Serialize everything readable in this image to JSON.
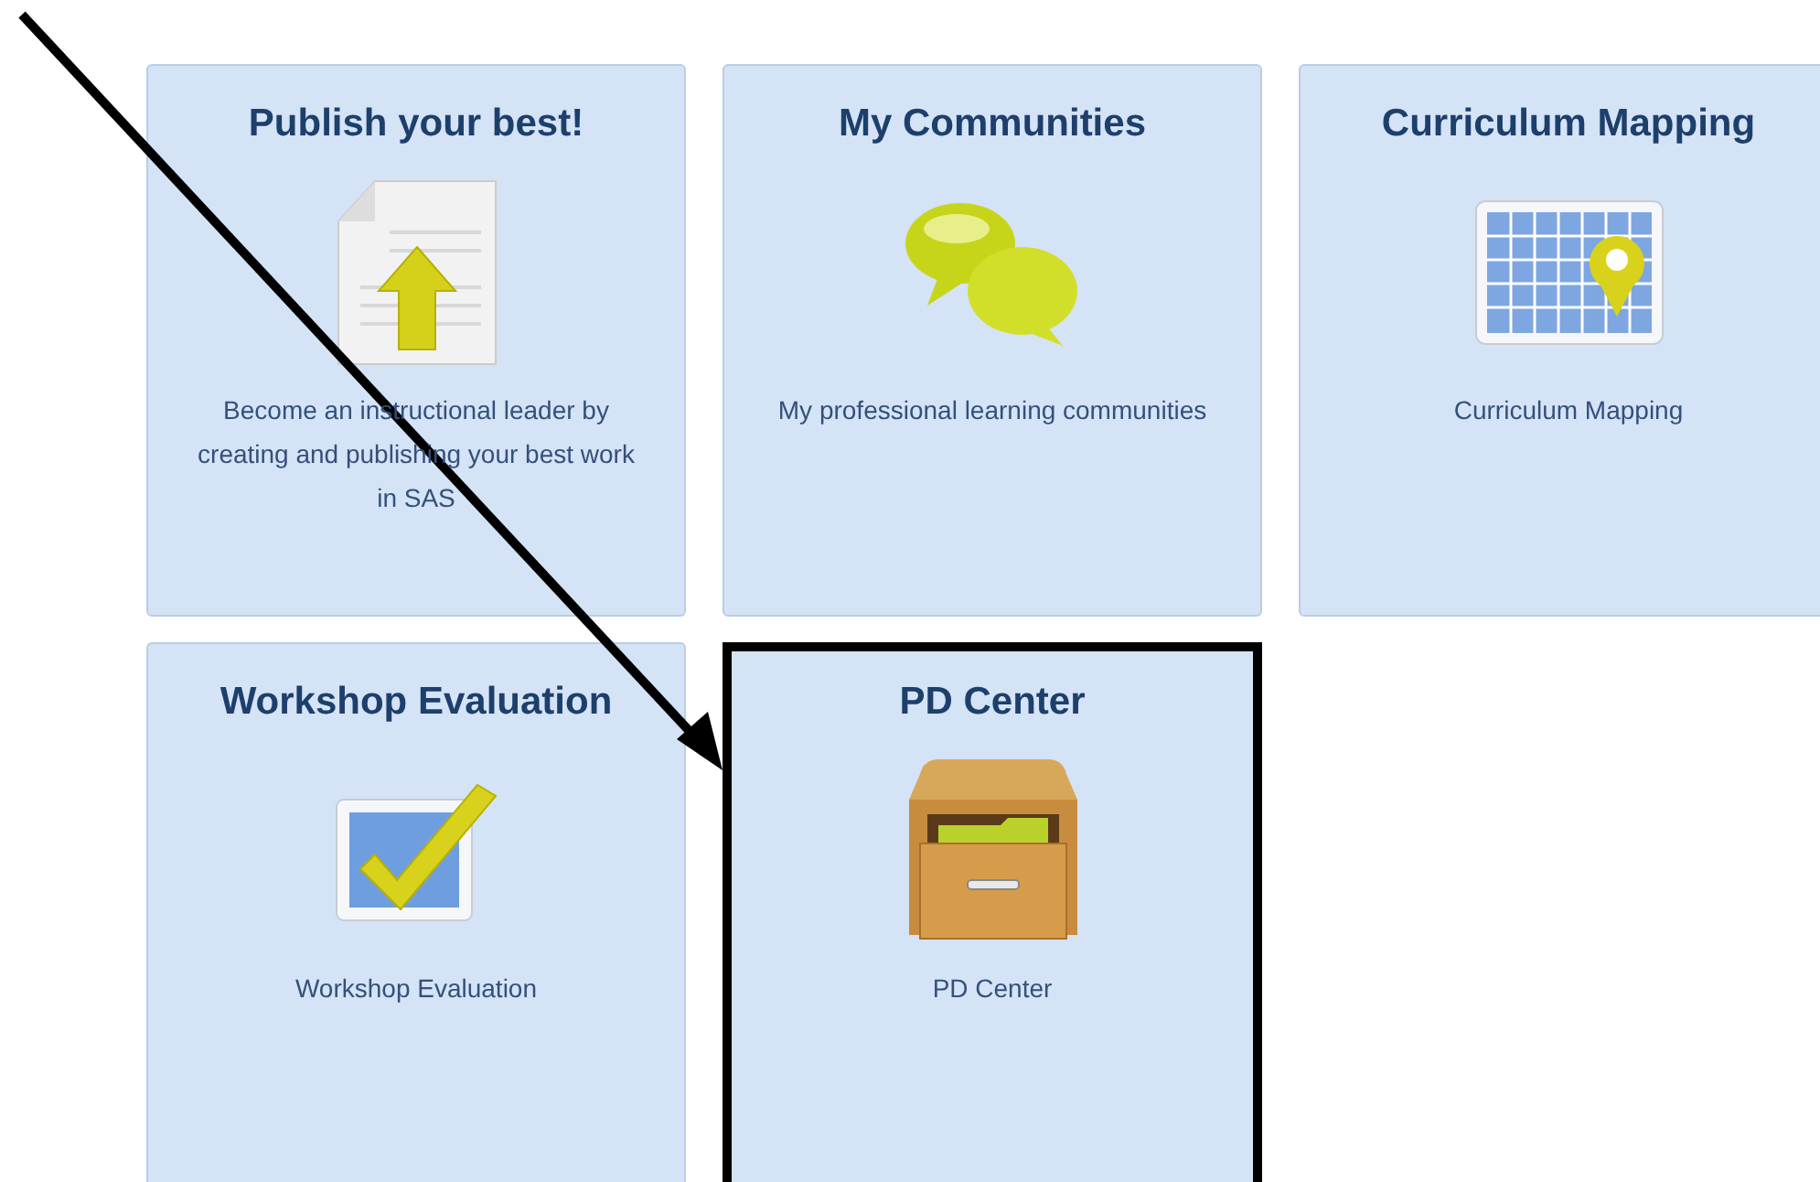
{
  "tiles": [
    {
      "title": "Publish your best!",
      "description": "Become an instructional leader by creating and publishing your best work in SAS",
      "highlighted": false
    },
    {
      "title": "My Communities",
      "description": "My professional learning communities",
      "highlighted": false
    },
    {
      "title": "Curriculum Mapping",
      "description": "Curriculum Mapping",
      "highlighted": false
    },
    {
      "title": "Workshop Evaluation",
      "description": "Workshop Evaluation",
      "highlighted": false
    },
    {
      "title": "PD Center",
      "description": "PD Center",
      "highlighted": true
    }
  ]
}
